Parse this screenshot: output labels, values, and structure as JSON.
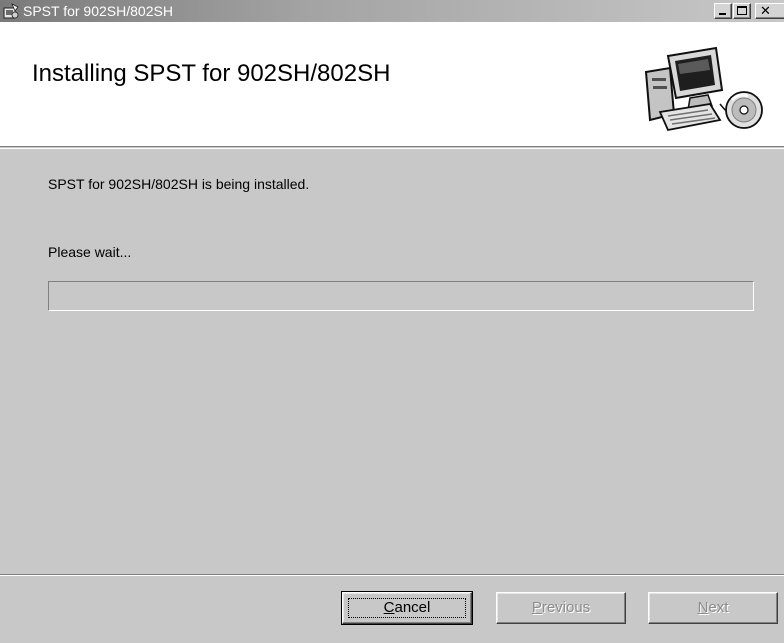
{
  "window": {
    "title": "SPST for 902SH/802SH",
    "controls": [
      "minimize-icon",
      "maximize-icon",
      "close-icon"
    ]
  },
  "banner": {
    "title": "Installing SPST for 902SH/802SH",
    "art_icon": "computer-cd-icon"
  },
  "body": {
    "status": "SPST for 902SH/802SH is being installed.",
    "wait": "Please wait...",
    "progress": 0
  },
  "buttons": {
    "cancel": {
      "mnemonic": "C",
      "rest": "ancel"
    },
    "previous": {
      "mnemonic": "P",
      "rest": "revious"
    },
    "next": {
      "mnemonic": "N",
      "rest": "ext"
    }
  }
}
